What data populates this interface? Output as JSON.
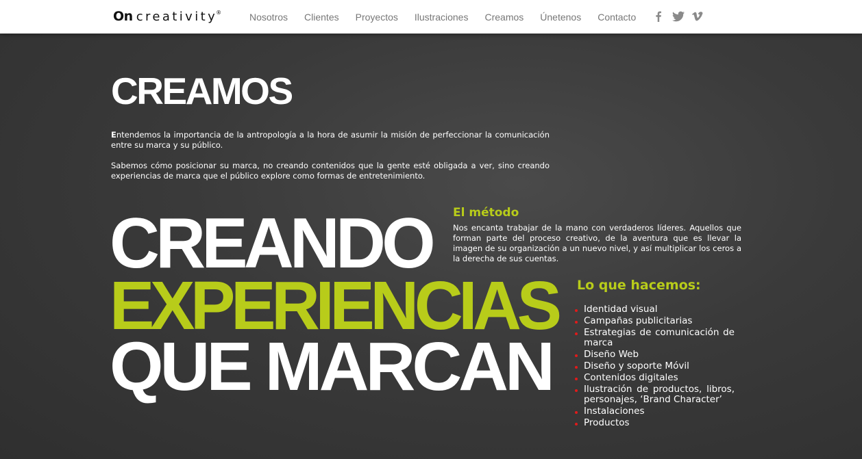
{
  "header": {
    "logo_on": "On",
    "logo_rest": "creativity",
    "logo_reg": "®",
    "nav": [
      {
        "label": "Nosotros"
      },
      {
        "label": "Clientes"
      },
      {
        "label": "Proyectos"
      },
      {
        "label": "Ilustraciones"
      },
      {
        "label": "Creamos"
      },
      {
        "label": "Únetenos"
      },
      {
        "label": "Contacto"
      }
    ],
    "social": [
      {
        "icon": "facebook-icon"
      },
      {
        "icon": "twitter-icon"
      },
      {
        "icon": "vimeo-icon"
      }
    ]
  },
  "main": {
    "title": "CREAMOS",
    "intro": {
      "p1_lead": "E",
      "p1_rest": "ntendemos la importancia de la antropología a la hora de asumir la misión de perfeccionar la comunicación entre su marca y su público.",
      "p2": "Sabemos cómo posicionar su marca, no creando contenidos que la gente esté obligada a ver, sino creando experiencias de marca que el público explore como formas de entretenimiento."
    },
    "big": {
      "line1": "CREANDO",
      "line2": "EXPERIENCIAS",
      "line3": "QUE MARCAN"
    },
    "metodo": {
      "title": "El método",
      "text": "Nos encanta trabajar de la mano con verdaderos líderes. Aquellos que forman parte del proceso creativo, de la aventura que es llevar la imagen de su organización a un nuevo nivel, y así multiplicar los ceros a la derecha de sus cuentas."
    },
    "hacemos": {
      "title": "Lo que hacemos:",
      "items": [
        "Identidad visual",
        "Campañas publicitarias",
        "Estrategias de comunicación de marca",
        "Diseño Web",
        "Diseño y soporte Móvil",
        "Contenidos digitales",
        "Ilustración de productos, libros, personajes, ‘Brand Character’",
        "Instalaciones",
        "Productos"
      ]
    }
  },
  "colors": {
    "accent": "#b8cc1a",
    "bullet": "#e21a1a",
    "background": "#3a3a3a",
    "topbar": "#ffffff"
  }
}
